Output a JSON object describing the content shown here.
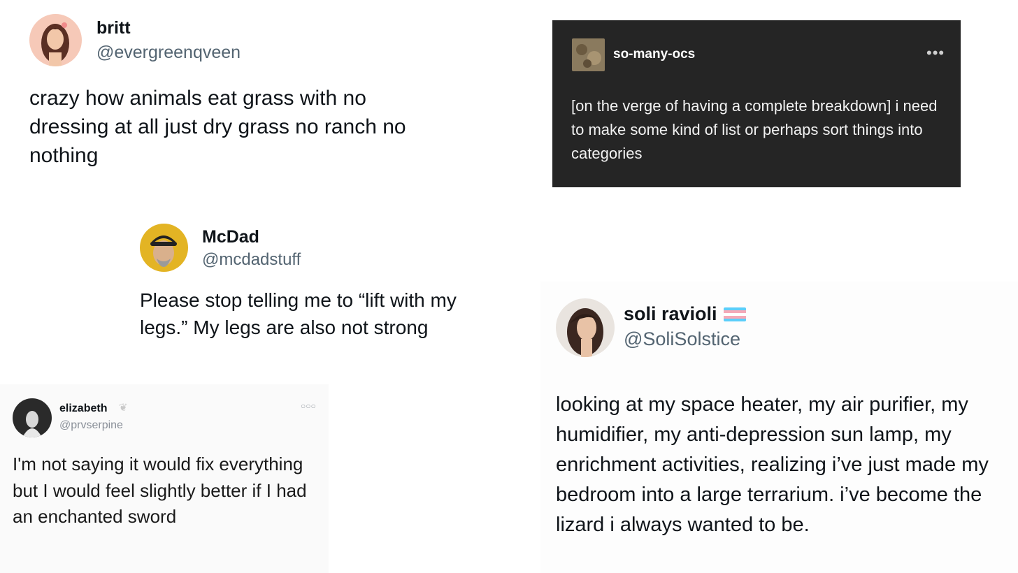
{
  "posts": {
    "britt": {
      "name": "britt",
      "handle": "@evergreenqveen",
      "text": "crazy how animals eat grass with no dressing at all just dry grass no ranch no nothing"
    },
    "tumblr": {
      "name": "so-many-ocs",
      "menu_icon": "more-dots-icon",
      "text": "[on the verge of having a complete breakdown] i need to make some kind of list or perhaps sort things into categories"
    },
    "mcdad": {
      "name": "McDad",
      "handle": "@mcdadstuff",
      "text": "Please stop telling me to “lift with my legs.” My legs are also not strong"
    },
    "elizabeth": {
      "name": "elizabeth",
      "handle": "@prvserpine",
      "menu_icon": "more-dots-icon",
      "text": "I'm not saying it would fix everything but I would feel slightly better if I had an enchanted sword"
    },
    "soli": {
      "name": "soli ravioli",
      "handle": "@SoliSolstice",
      "flag_icon": "trans-flag-icon",
      "text": "looking at my space heater, my air purifier, my humidifier, my anti-depression sun lamp, my enrichment activities, realizing i’ve just made my bedroom into a large terrarium. i’ve become the lizard i always wanted to be."
    }
  },
  "colors": {
    "handle": "#536471",
    "tumblr_bg": "#252525",
    "flag_blue": "#5bcefa",
    "flag_pink": "#f5a9b8"
  }
}
